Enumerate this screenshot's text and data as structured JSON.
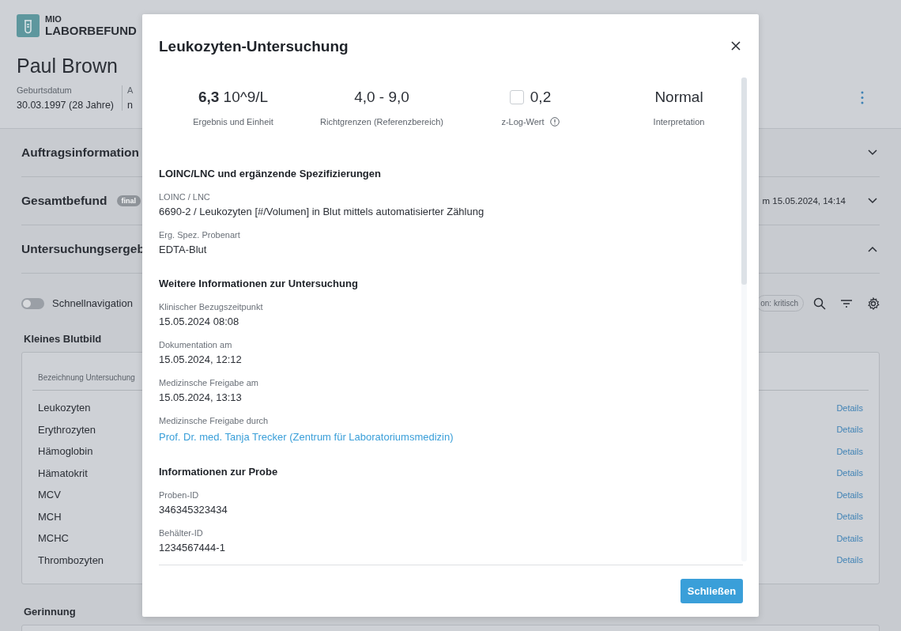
{
  "app": {
    "logo_top": "MIO",
    "logo_bottom": "LABORBEFUND"
  },
  "patient": {
    "name": "Paul Brown",
    "fields": [
      {
        "label": "Geburtsdatum",
        "value": "30.03.1997 (28 Jahre)"
      },
      {
        "label": "A",
        "value": "n"
      }
    ]
  },
  "sections": [
    {
      "title": "Auftragsinformation",
      "expanded": false
    },
    {
      "title": "Gesamtbefund",
      "badge": "final",
      "info": "m 15.05.2024, 14:14",
      "expanded": false
    },
    {
      "title": "Untersuchungsergeb",
      "expanded": true
    }
  ],
  "toolbar": {
    "toggle": {
      "label": "Schnellnavigation",
      "on": false
    },
    "filter_chip": "on: kritisch"
  },
  "groups": [
    {
      "title": "Kleines Blutbild",
      "column": "Bezeichnung Untersuchung",
      "rows": [
        {
          "name": "Leukozyten",
          "action": "Details"
        },
        {
          "name": "Erythrozyten",
          "action": "Details"
        },
        {
          "name": "Hämoglobin",
          "action": "Details"
        },
        {
          "name": "Hämatokrit",
          "action": "Details"
        },
        {
          "name": "MCV",
          "action": "Details"
        },
        {
          "name": "MCH",
          "action": "Details"
        },
        {
          "name": "MCHC",
          "action": "Details"
        },
        {
          "name": "Thrombozyten",
          "action": "Details"
        }
      ]
    },
    {
      "title": "Gerinnung"
    }
  ],
  "dialog": {
    "title": "Leukozyten-Untersuchung",
    "stats": [
      {
        "kind": "result",
        "value": "6,3",
        "unit": "10^9/L",
        "label": "Ergebnis und Einheit"
      },
      {
        "kind": "plain",
        "value": "4,0 - 9,0",
        "label": "Richtgrenzen (Referenzbereich)"
      },
      {
        "kind": "zlog",
        "checked": false,
        "value": "0,2",
        "label": "z-Log-Wert"
      },
      {
        "kind": "plain",
        "value": "Normal",
        "label": "Interpretation"
      }
    ],
    "sections": [
      {
        "heading": "LOINC/LNC und ergänzende Spezifizierungen",
        "fields": [
          {
            "label": "LOINC / LNC",
            "value": "6690-2 / Leukozyten [#/Volumen] in Blut mittels automatisierter Zählung",
            "kind": "text"
          },
          {
            "label": "Erg. Spez. Probenart",
            "value": "EDTA-Blut",
            "kind": "text"
          }
        ]
      },
      {
        "heading": "Weitere Informationen zur Untersuchung",
        "fields": [
          {
            "label": "Klinischer Bezugszeitpunkt",
            "value": "15.05.2024  08:08",
            "kind": "text"
          },
          {
            "label": "Dokumentation am",
            "value": "15.05.2024, 12:12",
            "kind": "text"
          },
          {
            "label": "Medizinsche Freigabe am",
            "value": "15.05.2024, 13:13",
            "kind": "text"
          },
          {
            "label": "Medizinsche Freigabe durch",
            "value": "Prof. Dr. med. Tanja Trecker (Zentrum für Laboratoriumsmedizin)",
            "kind": "link"
          }
        ]
      },
      {
        "heading": "Informationen zur Probe",
        "fields": [
          {
            "label": "Proben-ID",
            "value": "346345323434",
            "kind": "text"
          },
          {
            "label": "Behälter-ID",
            "value": "1234567444-1",
            "kind": "text"
          }
        ]
      }
    ],
    "button": "Schließen"
  }
}
